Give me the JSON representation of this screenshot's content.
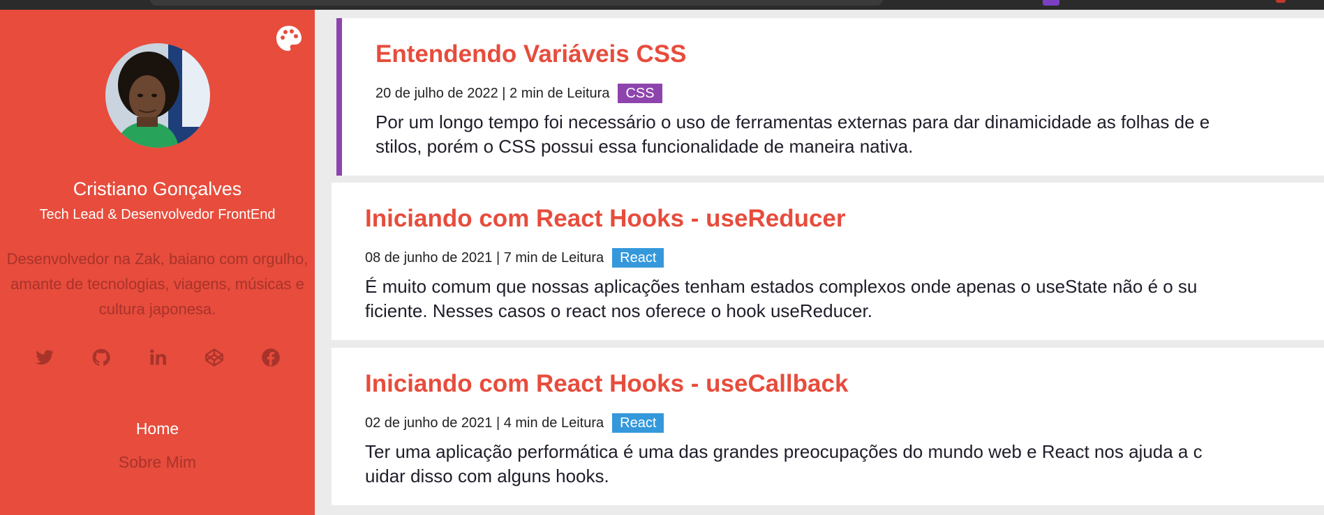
{
  "colors": {
    "accent": "#e74c3c",
    "sidebar_muted_text": "#a8332a",
    "active_post_border": "#8e44ad",
    "tag_css": "#8e44ad",
    "tag_react": "#3498db"
  },
  "sidebar": {
    "theme_icon": "palette-icon",
    "author_name": "Cristiano Gonçalves",
    "author_role": "Tech Lead & Desenvolvedor FrontEnd",
    "bio": "Desenvolvedor na Zak, baiano com orgulho, amante de tecnologias, viagens, músicas e cultura japonesa.",
    "social": [
      {
        "icon": "twitter-icon"
      },
      {
        "icon": "github-icon"
      },
      {
        "icon": "linkedin-icon"
      },
      {
        "icon": "codepen-icon"
      },
      {
        "icon": "facebook-icon"
      }
    ],
    "nav": {
      "home": "Home",
      "about": "Sobre Mim"
    }
  },
  "posts": [
    {
      "title": "Entendendo Variáveis CSS",
      "meta": "20 de julho de 2022 | 2 min de Leitura",
      "tag": "CSS",
      "excerpt_line1": "Por um longo tempo foi necessário o uso de ferramentas externas para dar dinamicidade as folhas de e",
      "excerpt_line2": "stilos, porém o CSS possui essa funcionalidade de maneira nativa."
    },
    {
      "title": "Iniciando com React Hooks - useReducer",
      "meta": "08 de junho de 2021 | 7 min de Leitura",
      "tag": "React",
      "excerpt_line1": "É muito comum que nossas aplicações tenham estados complexos onde apenas o useState não é o su",
      "excerpt_line2": "ficiente. Nesses casos o react nos oferece o hook useReducer."
    },
    {
      "title": "Iniciando com React Hooks - useCallback",
      "meta": "02 de junho de 2021 | 4 min de Leitura",
      "tag": "React",
      "excerpt_line1": "Ter uma aplicação performática é uma das grandes preocupações do mundo web e React nos ajuda a c",
      "excerpt_line2": "uidar disso com alguns hooks."
    }
  ]
}
